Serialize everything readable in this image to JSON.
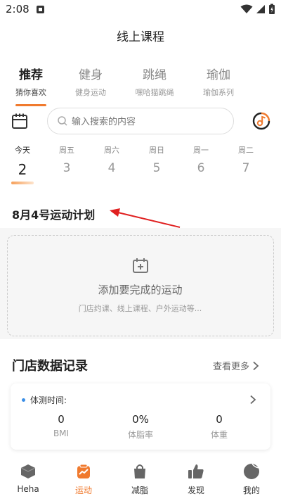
{
  "status_bar": {
    "time": "2:08"
  },
  "header": {
    "title": "线上课程"
  },
  "tabs": [
    {
      "label": "推荐",
      "sub": "猜你喜欢",
      "active": true
    },
    {
      "label": "健身",
      "sub": "健身运动",
      "active": false
    },
    {
      "label": "跳绳",
      "sub": "嘿哈猫跳绳",
      "active": false
    },
    {
      "label": "瑜伽",
      "sub": "瑜伽系列",
      "active": false
    }
  ],
  "search": {
    "placeholder": "输入搜索的内容"
  },
  "days": [
    {
      "name": "今天",
      "num": "2",
      "active": true
    },
    {
      "name": "周五",
      "num": "3"
    },
    {
      "name": "周六",
      "num": "4"
    },
    {
      "name": "周日",
      "num": "5"
    },
    {
      "name": "周一",
      "num": "6"
    },
    {
      "name": "周二",
      "num": "7"
    }
  ],
  "plan": {
    "title": "8月4号运动计划",
    "add_title": "添加要完成的运动",
    "add_sub": "门店约课、线上课程、户外运动等..."
  },
  "store_records": {
    "title": "门店数据记录",
    "more": "查看更多",
    "label": "体测时间:",
    "metrics": [
      {
        "value": "0",
        "label": "BMI"
      },
      {
        "value": "0%",
        "label": "体脂率"
      },
      {
        "value": "0",
        "label": "体重"
      }
    ]
  },
  "bottom_nav": [
    {
      "label": "Heha",
      "icon": "cube-icon"
    },
    {
      "label": "运动",
      "icon": "activity-icon",
      "active": true
    },
    {
      "label": "减脂",
      "icon": "shopping-bag-icon"
    },
    {
      "label": "发现",
      "icon": "thumbs-up-icon"
    },
    {
      "label": "我的",
      "icon": "profile-icon"
    }
  ],
  "colors": {
    "accent": "#f07a2e",
    "annotation": "#e02020",
    "info_dot": "#3a8ee6"
  }
}
